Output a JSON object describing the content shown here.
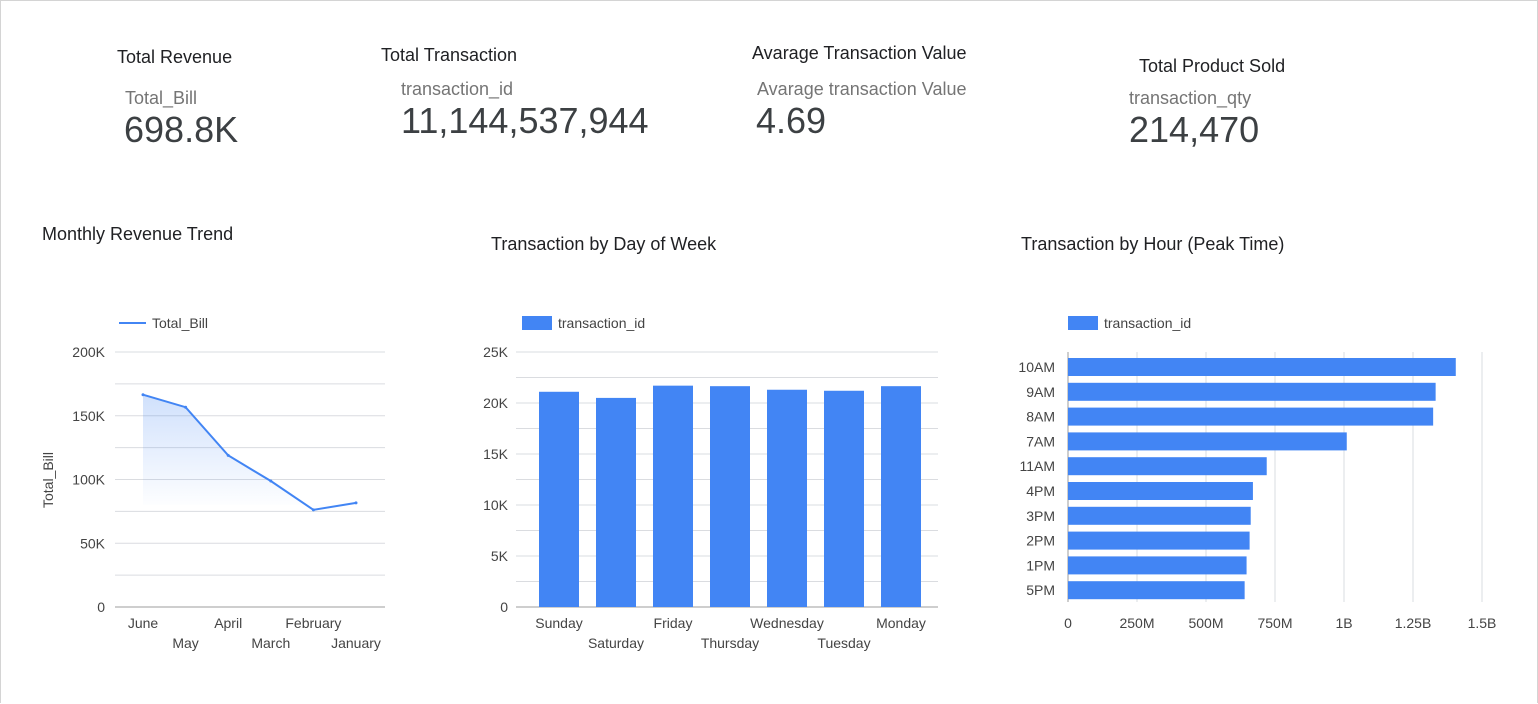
{
  "kpis": [
    {
      "title": "Total Revenue",
      "label": "Total_Bill",
      "value": "698.8K"
    },
    {
      "title": "Total Transaction",
      "label": "transaction_id",
      "value": "11,144,537,944"
    },
    {
      "title": "Avarage Transaction Value",
      "label": "Avarage transaction Value",
      "value": "4.69"
    },
    {
      "title": "Total Product Sold",
      "label": "transaction_qty",
      "value": "214,470"
    }
  ],
  "colors": {
    "series": "#4285f4",
    "grid": "#dadce0",
    "axis": "#9e9e9e",
    "tick_text": "#444444"
  },
  "chart_data": [
    {
      "type": "area",
      "title": "Monthly Revenue Trend",
      "categories": [
        "June",
        "May",
        "April",
        "March",
        "February",
        "January"
      ],
      "series": [
        {
          "name": "Total_Bill",
          "values": [
            166500,
            156700,
            118900,
            98800,
            76200,
            81700
          ]
        }
      ],
      "xlabel": "",
      "ylabel": "Total_Bill",
      "ylim": [
        0,
        200000
      ],
      "yticks": [
        "0",
        "50K",
        "100K",
        "150K",
        "200K"
      ],
      "grid": true,
      "legend": "top-left"
    },
    {
      "type": "bar",
      "title": "Transaction by Day of Week",
      "categories": [
        "Sunday",
        "Saturday",
        "Friday",
        "Thursday",
        "Wednesday",
        "Tuesday",
        "Monday"
      ],
      "series": [
        {
          "name": "transaction_id",
          "values": [
            21100,
            20500,
            21700,
            21650,
            21300,
            21200,
            21650
          ]
        }
      ],
      "xlabel": "",
      "ylabel": "",
      "ylim": [
        0,
        25000
      ],
      "yticks": [
        "0",
        "5K",
        "10K",
        "15K",
        "20K",
        "25K"
      ],
      "grid": true,
      "legend": "top-left"
    },
    {
      "type": "bar",
      "orientation": "horizontal",
      "title": "Transaction by Hour (Peak Time)",
      "categories": [
        "10AM",
        "9AM",
        "8AM",
        "7AM",
        "11AM",
        "4PM",
        "3PM",
        "2PM",
        "1PM",
        "5PM"
      ],
      "series": [
        {
          "name": "transaction_id",
          "values": [
            1405000000,
            1332000000,
            1323000000,
            1010000000,
            720000000,
            670000000,
            662000000,
            658000000,
            647000000,
            640000000
          ]
        }
      ],
      "xlabel": "",
      "ylabel": "",
      "xlim": [
        0,
        1500000000
      ],
      "xticks": [
        "0",
        "250M",
        "500M",
        "750M",
        "1B",
        "1.25B",
        "1.5B"
      ],
      "grid": true,
      "legend": "top-left"
    }
  ]
}
